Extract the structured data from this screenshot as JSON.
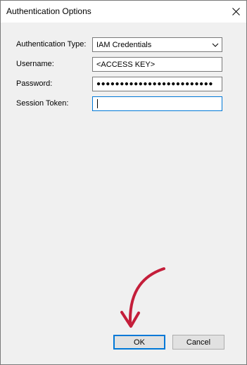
{
  "window": {
    "title": "Authentication Options"
  },
  "form": {
    "auth_type": {
      "label": "Authentication Type:",
      "value": "IAM Credentials"
    },
    "username": {
      "label": "Username:",
      "value": "<ACCESS KEY>"
    },
    "password": {
      "label": "Password:",
      "value": "●●●●●●●●●●●●●●●●●●●●●●●●●"
    },
    "session_token": {
      "label": "Session Token:",
      "value": ""
    }
  },
  "buttons": {
    "ok": "OK",
    "cancel": "Cancel"
  },
  "colors": {
    "focus_border": "#0078d7",
    "annotation_arrow": "#c41e3a"
  },
  "icons": {
    "close": "close-icon",
    "dropdown": "chevron-down-icon"
  }
}
